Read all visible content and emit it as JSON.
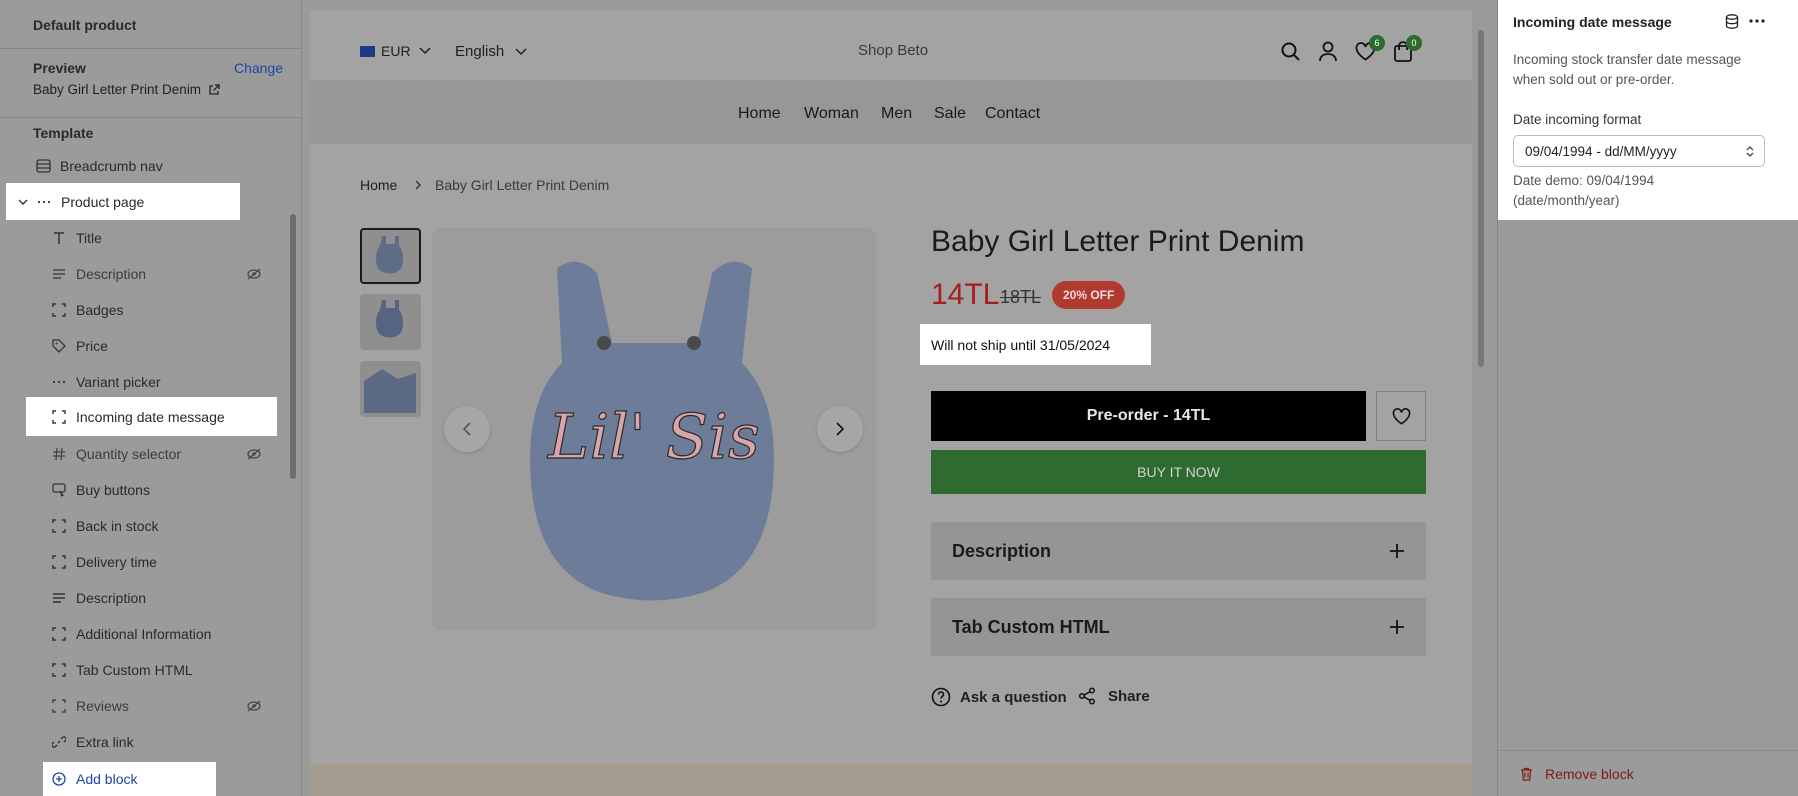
{
  "sidebar": {
    "header_title": "Default product",
    "preview_label": "Preview",
    "change_label": "Change",
    "preview_product": "Baby Girl Letter Print Denim",
    "template_label": "Template",
    "items": [
      {
        "label": "Breadcrumb nav",
        "icon": "section-icon"
      },
      {
        "label": "Product page",
        "icon": "dots-icon"
      },
      {
        "label": "Title",
        "icon": "text-icon"
      },
      {
        "label": "Description",
        "icon": "lines-icon"
      },
      {
        "label": "Badges",
        "icon": "block-icon"
      },
      {
        "label": "Price",
        "icon": "tag-icon"
      },
      {
        "label": "Variant picker",
        "icon": "dots-icon"
      },
      {
        "label": "Incoming date message",
        "icon": "block-icon"
      },
      {
        "label": "Quantity selector",
        "icon": "hash-icon"
      },
      {
        "label": "Buy buttons",
        "icon": "cursor-icon"
      },
      {
        "label": "Back in stock",
        "icon": "block-icon"
      },
      {
        "label": "Delivery time",
        "icon": "block-icon"
      },
      {
        "label": "Description",
        "icon": "lines-icon"
      },
      {
        "label": "Additional Information",
        "icon": "block-icon"
      },
      {
        "label": "Tab Custom HTML",
        "icon": "block-icon"
      },
      {
        "label": "Reviews",
        "icon": "block-icon"
      },
      {
        "label": "Extra link",
        "icon": "link-icon"
      }
    ],
    "add_block": "Add block"
  },
  "store": {
    "currency": "EUR",
    "language": "English",
    "shop_name": "Shop Beto",
    "wishlist_count": "6",
    "cart_count": "0",
    "nav": [
      "Home",
      "Woman",
      "Men",
      "Sale",
      "Contact"
    ],
    "breadcrumb_home": "Home",
    "breadcrumb_current": "Baby Girl Letter Print Denim"
  },
  "product": {
    "title": "Baby Girl Letter Print Denim",
    "price": "14TL",
    "compare_price": "18TL",
    "discount_badge": "20% OFF",
    "ship_message": "Will not ship until 31/05/2024",
    "preorder_label": "Pre-order - 14TL",
    "buy_now_label": "BUY IT NOW",
    "accordion_description": "Description",
    "accordion_tab": "Tab Custom HTML",
    "ask_question": "Ask a question",
    "share": "Share",
    "image_text": "Lil' Sis"
  },
  "panel": {
    "title": "Incoming date message",
    "description": "Incoming stock transfer date message when sold out or pre-order.",
    "format_label": "Date incoming format",
    "format_value": "09/04/1994 - dd/MM/yyyy",
    "demo_text": "Date demo: 09/04/1994 (date/month/year)",
    "remove_block": "Remove block"
  },
  "colors": {
    "highlight": "#ffffff",
    "price_red": "#a51d1d",
    "badge_red": "#b03a2e",
    "buy_green": "#2f6a30",
    "link_blue": "#1e44a8"
  }
}
